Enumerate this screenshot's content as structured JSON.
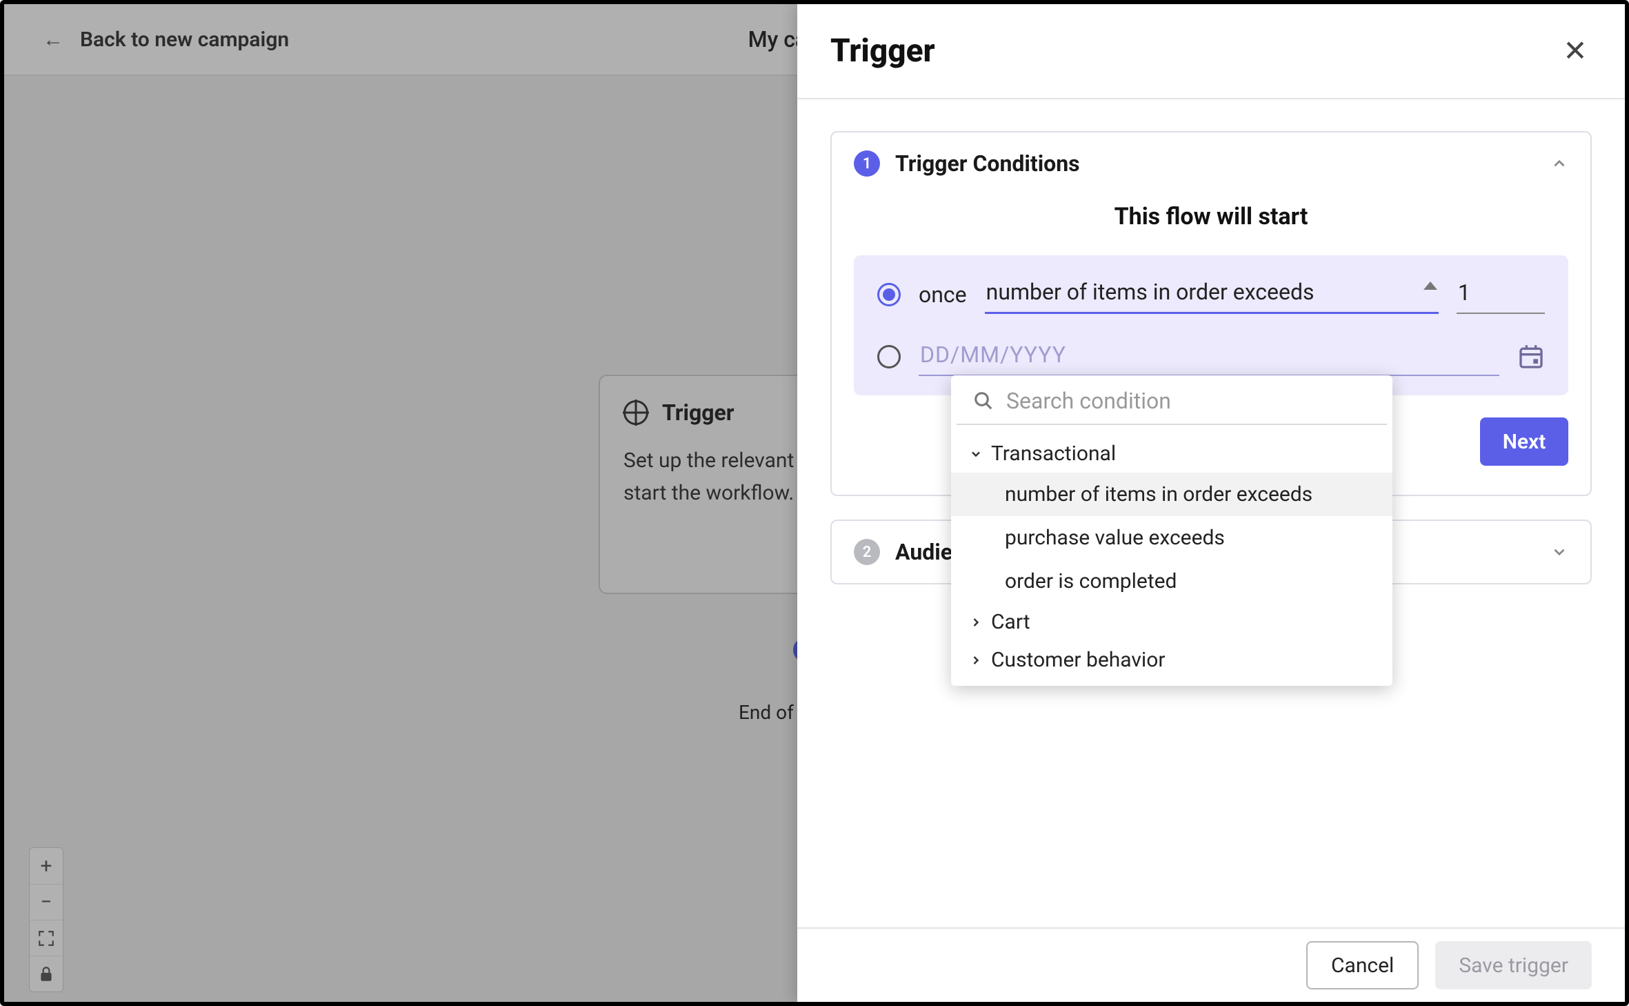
{
  "header": {
    "back_label": "Back to new campaign",
    "campaign_title": "My campaign"
  },
  "canvas": {
    "trigger_card_title": "Trigger",
    "trigger_card_body": "Set up the relevant trigger to start the workflow.",
    "end_label": "End of campaign"
  },
  "panel": {
    "title": "Trigger",
    "section1": {
      "step_num": "1",
      "title": "Trigger Conditions",
      "flow_start_label": "This flow will start",
      "radio_once_label": "once",
      "selected_condition": "number of items in order exceeds",
      "number_value": "1",
      "date_placeholder": "DD/MM/YYYY",
      "next_button": "Next"
    },
    "section2": {
      "step_num": "2",
      "title": "Audience"
    },
    "footer": {
      "cancel": "Cancel",
      "save": "Save trigger"
    }
  },
  "dropdown": {
    "search_placeholder": "Search condition",
    "groups": [
      {
        "label": "Transactional",
        "expanded": true,
        "items": [
          "number of items in order exceeds",
          "purchase value exceeds",
          "order is completed"
        ]
      },
      {
        "label": "Cart",
        "expanded": false
      },
      {
        "label": "Customer behavior",
        "expanded": false
      }
    ]
  }
}
